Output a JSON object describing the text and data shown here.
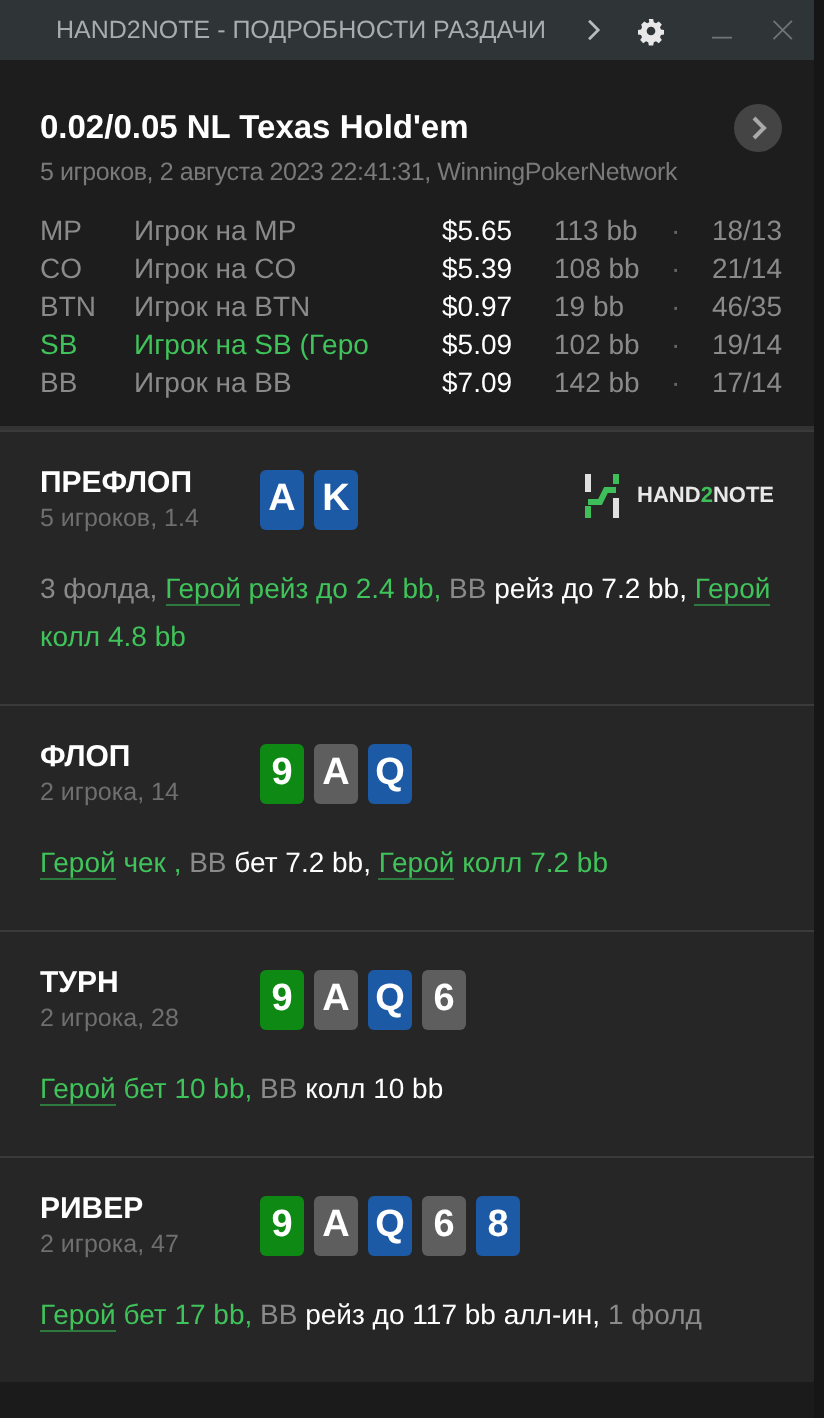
{
  "window": {
    "title": "HAND2NOTE - ПОДРОБНОСТИ РАЗДАЧИ"
  },
  "hand": {
    "game": "0.02/0.05 NL Texas Hold'em",
    "info": "5 игроков, 2 августа 2023 22:41:31, WinningPokerNetwork"
  },
  "players": [
    {
      "position": "MP",
      "name": "Игрок на MP",
      "stack": "$5.65",
      "bb": "113 bb",
      "separator": "·",
      "stats": "18/13",
      "hero": false
    },
    {
      "position": "CO",
      "name": "Игрок на CO",
      "stack": "$5.39",
      "bb": "108 bb",
      "separator": "·",
      "stats": "21/14",
      "hero": false
    },
    {
      "position": "BTN",
      "name": "Игрок на BTN",
      "stack": "$0.97",
      "bb": "19 bb",
      "separator": "·",
      "stats": "46/35",
      "hero": false
    },
    {
      "position": "SB",
      "name": "Игрок на SB",
      "note": "(Геро",
      "stack": "$5.09",
      "bb": "102 bb",
      "separator": "·",
      "stats": "19/14",
      "hero": true
    },
    {
      "position": "BB",
      "name": "Игрок на BB",
      "stack": "$7.09",
      "bb": "142 bb",
      "separator": "·",
      "stats": "17/14",
      "hero": false
    }
  ],
  "logo": {
    "text_a": "HAND",
    "accent": "2",
    "text_b": "NOTE"
  },
  "streets": [
    {
      "name": "ПРЕФЛОП",
      "info": "5 игроков, 1.4",
      "logo": true,
      "cards": [
        {
          "rank": "A",
          "color": "#1c5aa6"
        },
        {
          "rank": "K",
          "color": "#1c5aa6"
        }
      ],
      "actions": [
        {
          "kind": "muted",
          "text": "3 фолда,"
        },
        {
          "kind": "link",
          "text": "Герой"
        },
        {
          "kind": "hero",
          "text": "рейз до 2.4 bb,"
        },
        {
          "kind": "muted",
          "text": "BB"
        },
        {
          "kind": "plain",
          "text": "рейз до 7.2 bb,"
        },
        {
          "kind": "link",
          "text": "Герой"
        },
        {
          "kind": "hero",
          "text": "колл 4.8 bb"
        }
      ]
    },
    {
      "name": "ФЛОП",
      "info": "2 игрока, 14",
      "logo": false,
      "cards": [
        {
          "rank": "9",
          "color": "#0e8a14"
        },
        {
          "rank": "A",
          "color": "#5e5e5e"
        },
        {
          "rank": "Q",
          "color": "#1c5aa6"
        }
      ],
      "actions": [
        {
          "kind": "link",
          "text": "Герой"
        },
        {
          "kind": "hero",
          "text": "чек ,"
        },
        {
          "kind": "muted",
          "text": "BB"
        },
        {
          "kind": "plain",
          "text": "бет 7.2 bb,"
        },
        {
          "kind": "link",
          "text": "Герой"
        },
        {
          "kind": "hero",
          "text": "колл 7.2 bb"
        }
      ]
    },
    {
      "name": "ТУРН",
      "info": "2 игрока, 28",
      "logo": false,
      "cards": [
        {
          "rank": "9",
          "color": "#0e8a14"
        },
        {
          "rank": "A",
          "color": "#5e5e5e"
        },
        {
          "rank": "Q",
          "color": "#1c5aa6"
        },
        {
          "rank": "6",
          "color": "#5e5e5e"
        }
      ],
      "actions": [
        {
          "kind": "link",
          "text": "Герой"
        },
        {
          "kind": "hero",
          "text": "бет 10 bb,"
        },
        {
          "kind": "muted",
          "text": "BB"
        },
        {
          "kind": "plain",
          "text": "колл 10 bb"
        }
      ]
    },
    {
      "name": "РИВЕР",
      "info": "2 игрока, 47",
      "logo": false,
      "cards": [
        {
          "rank": "9",
          "color": "#0e8a14"
        },
        {
          "rank": "A",
          "color": "#5e5e5e"
        },
        {
          "rank": "Q",
          "color": "#1c5aa6"
        },
        {
          "rank": "6",
          "color": "#5e5e5e"
        },
        {
          "rank": "8",
          "color": "#1c5aa6"
        }
      ],
      "actions": [
        {
          "kind": "link",
          "text": "Герой"
        },
        {
          "kind": "hero",
          "text": "бет 17 bb,"
        },
        {
          "kind": "muted",
          "text": "BB"
        },
        {
          "kind": "plain",
          "text": "рейз до 117 bb алл-ин,"
        },
        {
          "kind": "muted",
          "text": "1 фолд"
        }
      ]
    }
  ]
}
